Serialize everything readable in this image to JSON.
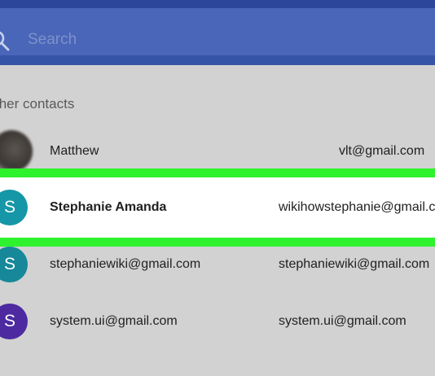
{
  "search": {
    "placeholder": "Search",
    "icon": "search-icon"
  },
  "section_title": "ther contacts",
  "contacts": [
    {
      "name": "Matthew",
      "email": "vlt@gmail.com",
      "avatar_type": "photo"
    },
    {
      "name": "Stephanie Amanda",
      "email": "wikihowstephanie@gmail.c",
      "avatar_letter": "S",
      "avatar_color": "#1597a7",
      "highlighted": true
    },
    {
      "name": "stephaniewiki@gmail.com",
      "email": "stephaniewiki@gmail.com",
      "avatar_letter": "S",
      "avatar_color": "#168899"
    },
    {
      "name": "system.ui@gmail.com",
      "email": "system.ui@gmail.com",
      "avatar_letter": "S",
      "avatar_color": "#4d2aa0"
    }
  ],
  "colors": {
    "header": "#3554a7",
    "search_bar": "#4a66b8",
    "background": "#d2d2d2",
    "highlight_outline": "#2ef22e"
  }
}
